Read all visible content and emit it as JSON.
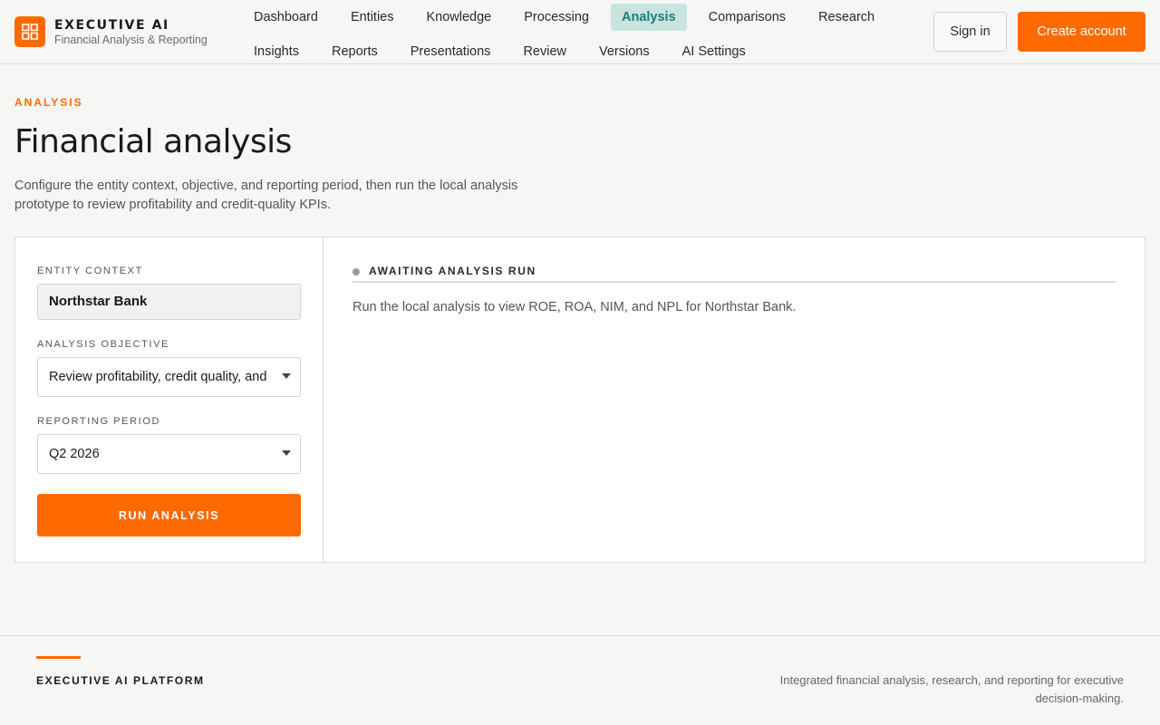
{
  "brand": {
    "name": "EXECUTIVE AI",
    "subtitle": "Financial Analysis & Reporting",
    "logo_icon": "grid-icon",
    "accent_color": "#ff6a00"
  },
  "nav": {
    "row1": [
      "Dashboard",
      "Entities",
      "Knowledge",
      "Processing",
      "Analysis",
      "Comparisons",
      "Research"
    ],
    "row2": [
      "Insights",
      "Reports",
      "Presentations",
      "Review",
      "Versions",
      "AI Settings"
    ],
    "active": "Analysis",
    "active_color": "#1b7f72"
  },
  "auth": {
    "sign_in": "Sign in",
    "create_account": "Create account"
  },
  "page": {
    "eyebrow": "ANALYSIS",
    "title": "Financial analysis",
    "description": "Configure the entity context, objective, and reporting period, then run the local analysis prototype to review profitability and credit-quality KPIs."
  },
  "form": {
    "entity_label": "ENTITY CONTEXT",
    "entity_value": "Northstar Bank",
    "objective_label": "ANALYSIS OBJECTIVE",
    "objective_value": "Review profitability, credit quality, and",
    "period_label": "REPORTING PERIOD",
    "period_value": "Q2 2026",
    "run_label": "RUN ANALYSIS"
  },
  "result": {
    "status": "AWAITING ANALYSIS RUN",
    "message": "Run the local analysis to view ROE, ROA, NIM, and NPL for Northstar Bank."
  },
  "footer": {
    "brand": "EXECUTIVE AI PLATFORM",
    "tagline": "Integrated financial analysis, research, and reporting for executive decision-making."
  }
}
